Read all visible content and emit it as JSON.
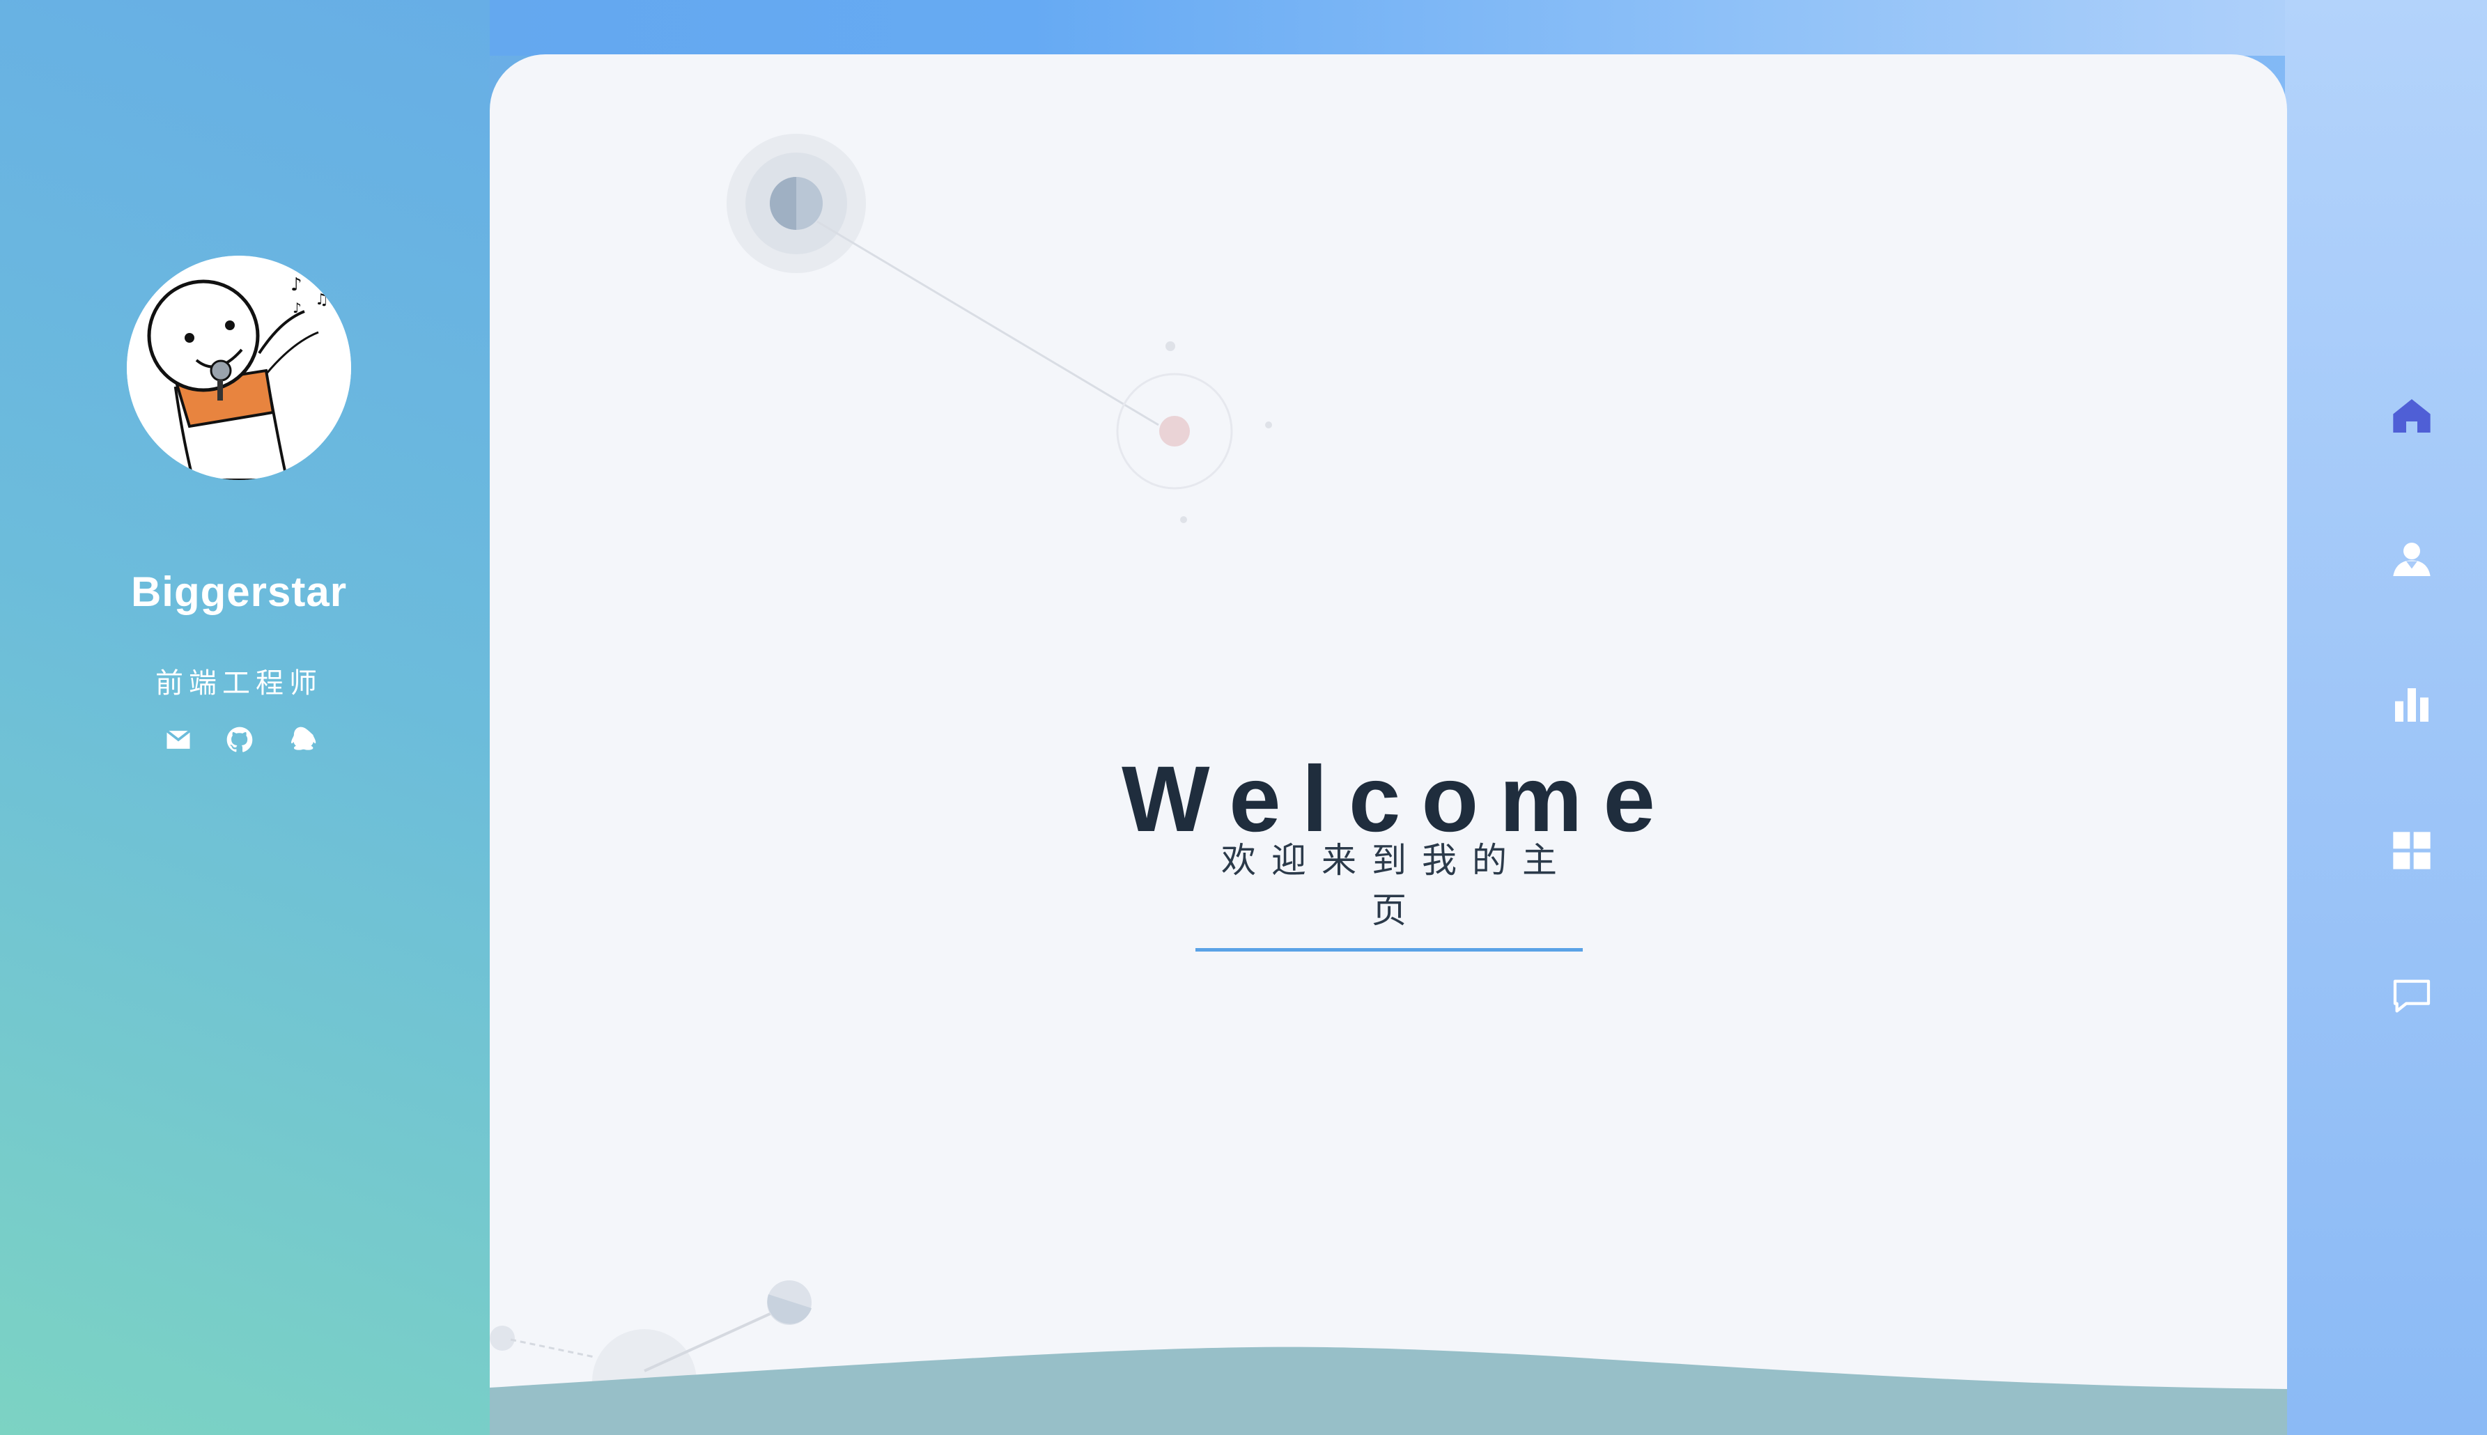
{
  "profile": {
    "name": "Biggerstar",
    "title": "前端工程师",
    "socials": [
      {
        "icon": "mail-icon"
      },
      {
        "icon": "github-icon"
      },
      {
        "icon": "qq-icon"
      }
    ]
  },
  "hero": {
    "title": "Welcome",
    "subtitle": "欢迎来到我的主页"
  },
  "nav": {
    "items": [
      {
        "icon": "home-icon",
        "active": true
      },
      {
        "icon": "user-icon",
        "active": false
      },
      {
        "icon": "bar-chart-icon",
        "active": false
      },
      {
        "icon": "grid-icon",
        "active": false
      },
      {
        "icon": "message-icon",
        "active": false
      }
    ]
  },
  "colors": {
    "accent": "#4f5fd6",
    "underline": "#5aa2e6",
    "title": "#1f2d3d",
    "card_bg": "#f4f6fa",
    "wave": "#97bfc8"
  }
}
